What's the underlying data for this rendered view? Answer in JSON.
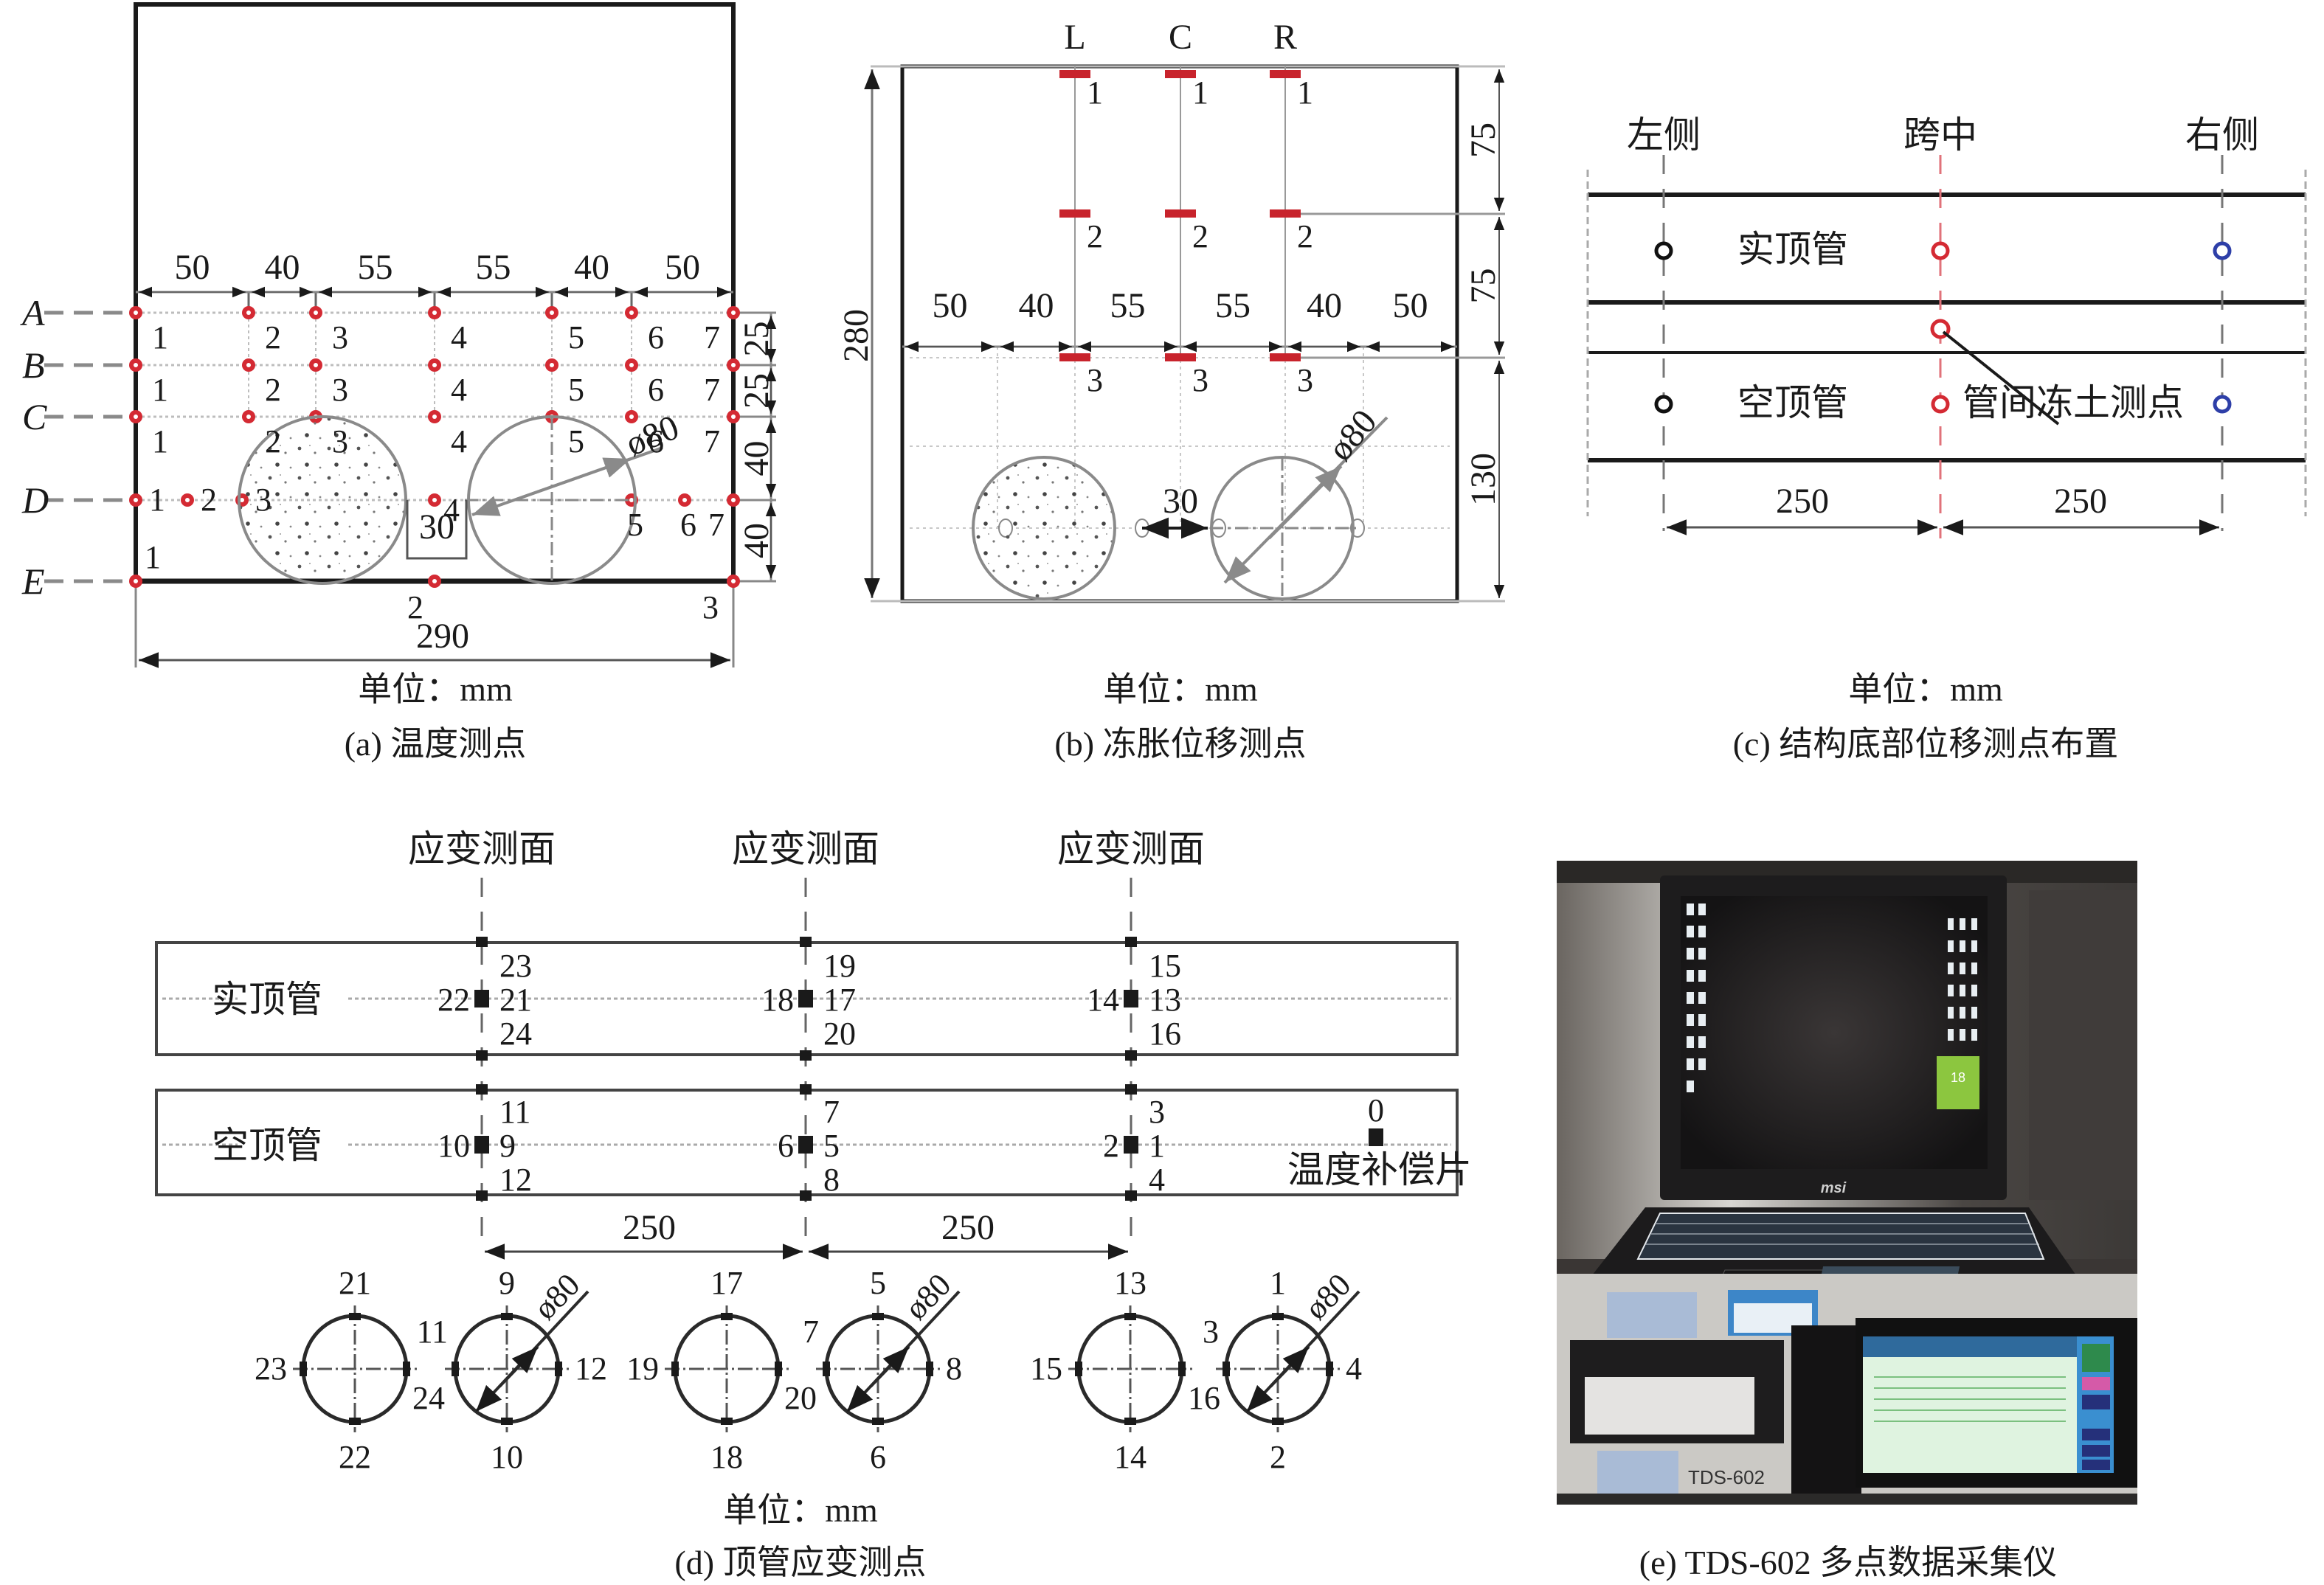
{
  "figure": {
    "unit_label": "单位：mm"
  },
  "panel_a": {
    "caption": "(a) 温度测点",
    "unit": "单位：mm",
    "row_labels": [
      "A",
      "B",
      "C",
      "D",
      "E"
    ],
    "top_dims": [
      "50",
      "40",
      "55",
      "55",
      "40",
      "50"
    ],
    "right_dims": [
      "25",
      "25",
      "40",
      "40"
    ],
    "bottom_dim": "290",
    "gap_dim": "30",
    "diameter": "ø80",
    "row_points": {
      "A": [
        "1",
        "2",
        "3",
        "4",
        "5",
        "6",
        "7"
      ],
      "B": [
        "1",
        "2",
        "3",
        "4",
        "5",
        "6",
        "7"
      ],
      "C": [
        "1",
        "2",
        "3",
        "4",
        "5",
        "6",
        "7"
      ],
      "D": [
        "1",
        "2",
        "3",
        "4",
        "5",
        "6",
        "7"
      ],
      "E": [
        "1",
        "2",
        "3"
      ]
    },
    "point_color": "#d42a33"
  },
  "panel_b": {
    "caption": "(b) 冻胀位移测点",
    "unit": "单位：mm",
    "column_labels": [
      "L",
      "C",
      "R"
    ],
    "point_numbers": [
      "1",
      "2",
      "3"
    ],
    "top_dims": [
      "50",
      "40",
      "55",
      "55",
      "40",
      "50"
    ],
    "right_dims": [
      "75",
      "75",
      "130"
    ],
    "left_dim": "280",
    "gap_dim": "30",
    "diameter": "ø80",
    "marker_color": "#c8232c"
  },
  "panel_c": {
    "caption": "(c) 结构底部位移测点布置",
    "unit": "单位：mm",
    "column_labels": [
      "左侧",
      "跨中",
      "右侧"
    ],
    "pipe_labels": [
      "实顶管",
      "空顶管"
    ],
    "callout": "管间冻土测点",
    "dims": [
      "250",
      "250"
    ],
    "point_colors": {
      "left": "#111111",
      "mid": "#d42a33",
      "right": "#2e3fa8"
    }
  },
  "panel_d": {
    "caption": "(d) 顶管应变测点",
    "unit": "单位：mm",
    "section_label": "应变测面",
    "pipe_labels": [
      "实顶管",
      "空顶管"
    ],
    "solid_pipe_sections": [
      {
        "top": "23",
        "left": "22",
        "center": "21",
        "bottom": "24"
      },
      {
        "top": "19",
        "left": "18",
        "center": "17",
        "bottom": "20"
      },
      {
        "top": "15",
        "left": "14",
        "center": "13",
        "bottom": "16"
      }
    ],
    "hollow_pipe_sections": [
      {
        "top": "11",
        "left": "10",
        "center": "9",
        "bottom": "12"
      },
      {
        "top": "7",
        "left": "6",
        "center": "5",
        "bottom": "8"
      },
      {
        "top": "3",
        "left": "2",
        "center": "1",
        "bottom": "4"
      }
    ],
    "compensator": {
      "number": "0",
      "label": "温度补偿片"
    },
    "dims": [
      "250",
      "250"
    ],
    "diameter": "ø80",
    "cross_sections": [
      {
        "solid": {
          "top": "21",
          "left": "23",
          "right": "24",
          "bottom": "22"
        },
        "hollow": {
          "top": "9",
          "left": "11",
          "right": "12",
          "bottom": "10"
        }
      },
      {
        "solid": {
          "top": "17",
          "left": "19",
          "right": "20",
          "bottom": "18"
        },
        "hollow": {
          "top": "5",
          "left": "7",
          "right": "8",
          "bottom": "6"
        }
      },
      {
        "solid": {
          "top": "13",
          "left": "15",
          "right": "16",
          "bottom": "14"
        },
        "hollow": {
          "top": "1",
          "left": "3",
          "right": "4",
          "bottom": "2"
        }
      }
    ]
  },
  "panel_e": {
    "caption": "(e) TDS-602 多点数据采集仪",
    "laptop_brand": "msi",
    "device_model": "TDS-602",
    "tile_number": "18"
  }
}
